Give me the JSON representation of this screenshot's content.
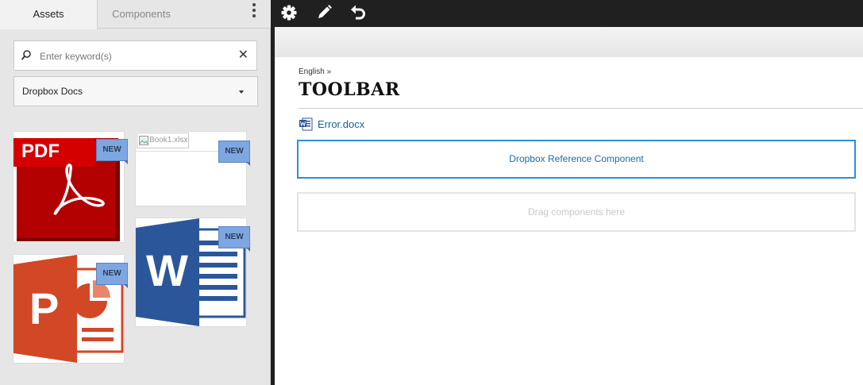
{
  "sidebar": {
    "tabs": [
      {
        "label": "Assets",
        "active": true
      },
      {
        "label": "Components",
        "active": false
      }
    ],
    "search": {
      "placeholder": "Enter keyword(s)",
      "value": ""
    },
    "source_select": {
      "value": "Dropbox Docs"
    },
    "assets": [
      {
        "kind": "pdf",
        "icon_text": "PDF",
        "badge": "NEW"
      },
      {
        "kind": "xlsx",
        "broken_image_alt": "Book1.xlsx",
        "badge": "NEW"
      },
      {
        "kind": "docx",
        "icon_text": "W",
        "badge": "NEW"
      },
      {
        "kind": "pptx",
        "icon_text": "P",
        "badge": "NEW"
      }
    ]
  },
  "toolbar": {
    "icons": [
      "gear-icon",
      "pencil-icon",
      "undo-icon"
    ]
  },
  "page": {
    "breadcrumb": "English",
    "breadcrumb_sep": "»",
    "title": "TOOLBAR",
    "document_link": "Error.docx",
    "dropbox_component": "Dropbox Reference Component",
    "drag_zone": "Drag components here"
  },
  "colors": {
    "toolbar_bg": "#202020",
    "link": "#1a5f96",
    "selected_border": "#2b8fd6",
    "badge": "#7ea6e0",
    "pdf_red": "#c00000",
    "word_blue": "#2b579a",
    "ppt_orange": "#d24726"
  }
}
